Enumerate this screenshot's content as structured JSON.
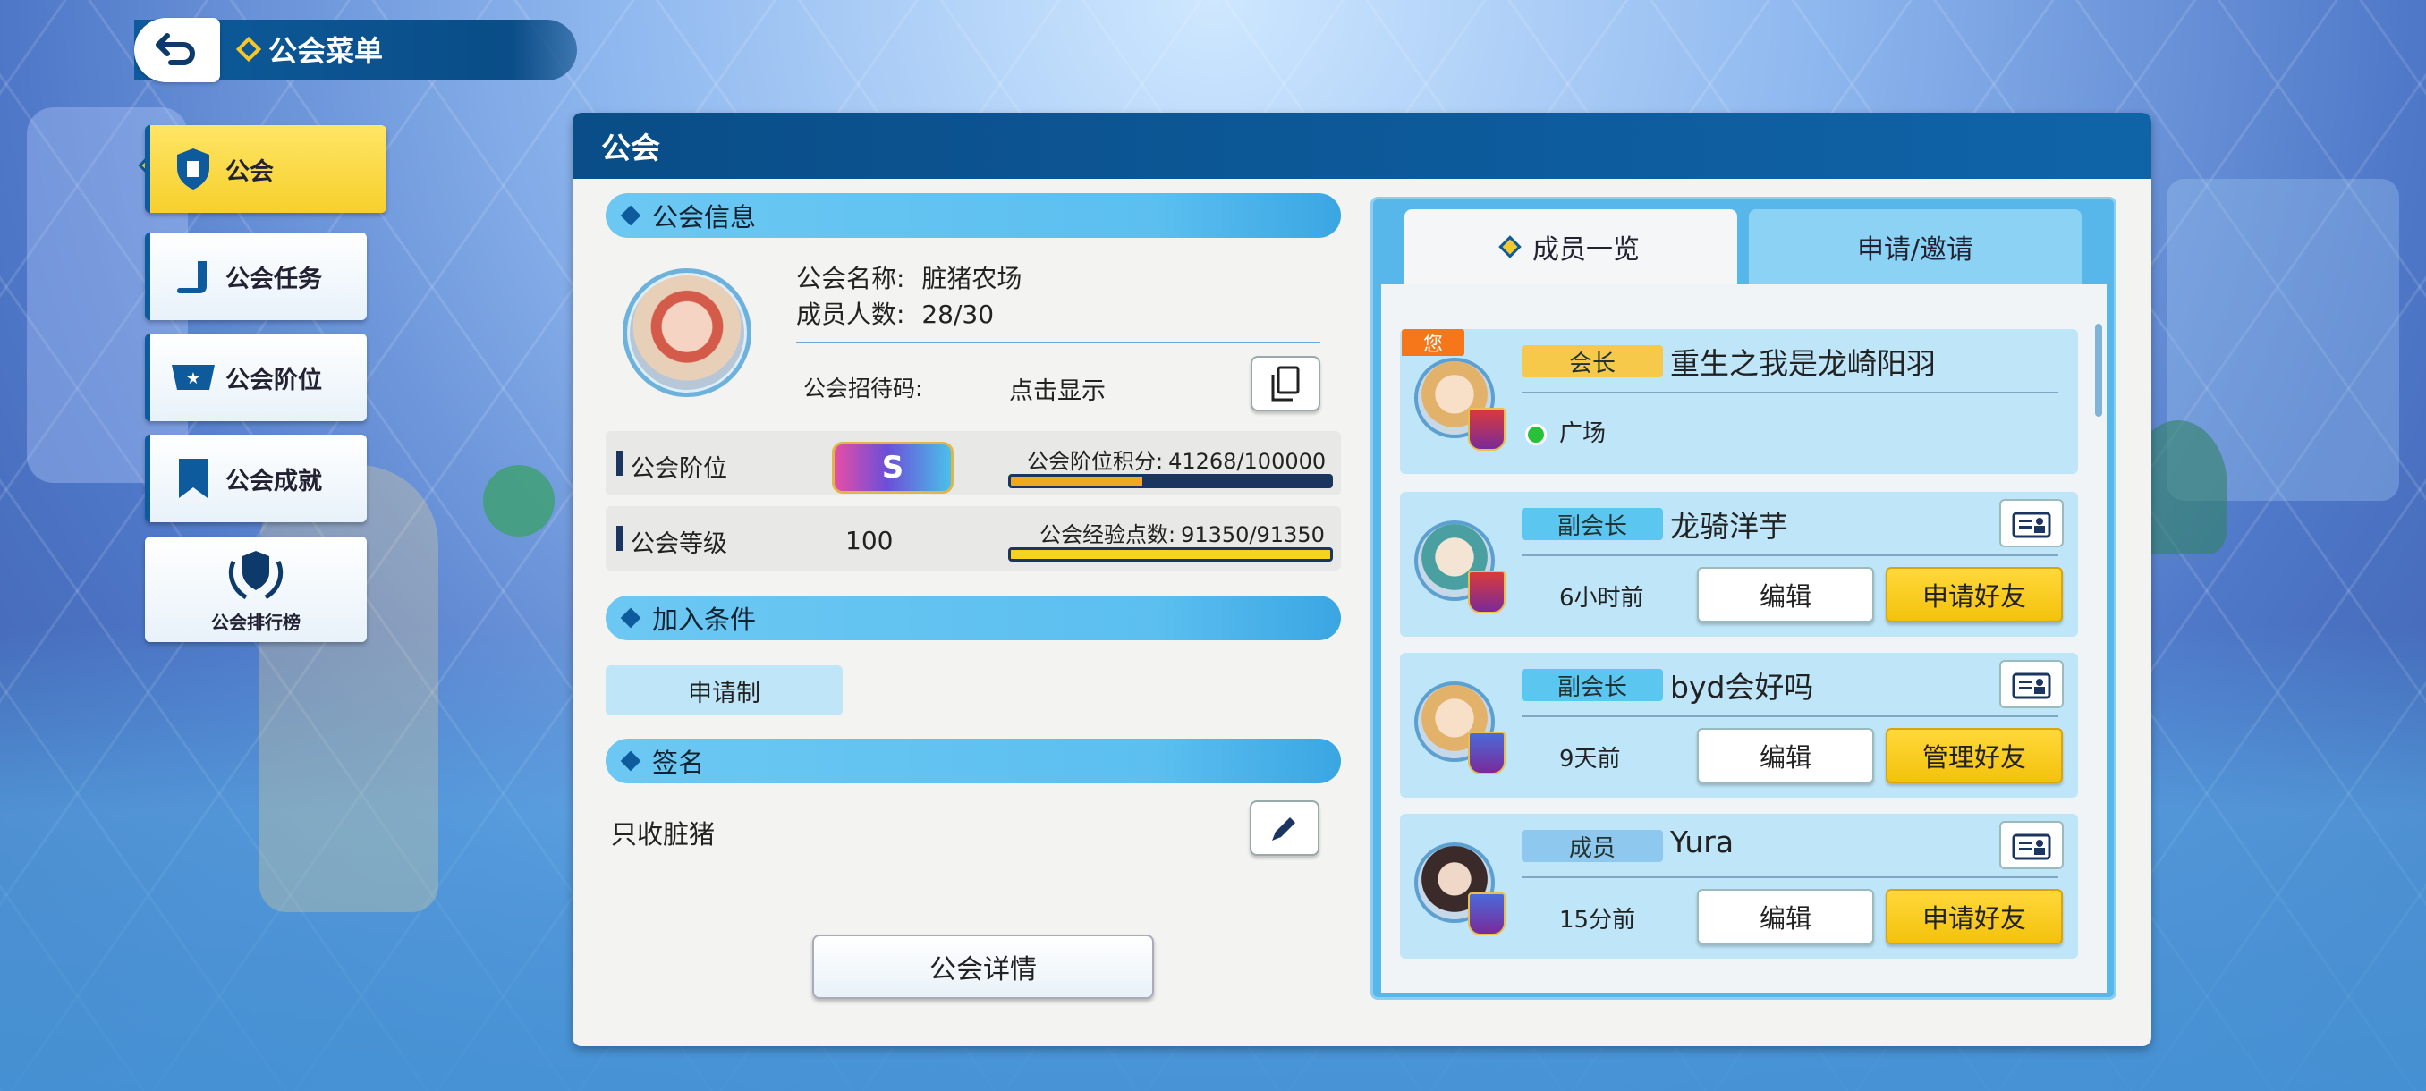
{
  "header": {
    "title": "公会菜单"
  },
  "sidebar": {
    "items": [
      {
        "label": "公会",
        "active": true
      },
      {
        "label": "公会任务"
      },
      {
        "label": "公会阶位"
      },
      {
        "label": "公会成就"
      },
      {
        "label": "公会排行榜"
      }
    ]
  },
  "panel": {
    "title": "公会"
  },
  "guild_info": {
    "section_title": "公会信息",
    "name_label": "公会名称:",
    "name_value": "脏猪农场",
    "members_label": "成员人数:",
    "members_value": "28/30",
    "invite_code_label": "公会招待码:",
    "invite_code_value": "点击显示",
    "rank_label": "公会阶位",
    "rank_grade": "S",
    "rank_points_label": "公会阶位积分:",
    "rank_points_value": "41268/100000",
    "rank_points_progress": 0.4127,
    "level_label": "公会等级",
    "level_value": "100",
    "exp_label": "公会经验点数:",
    "exp_value": "91350/91350",
    "exp_progress": 1.0
  },
  "join_conditions": {
    "section_title": "加入条件",
    "value": "申请制"
  },
  "signature": {
    "section_title": "签名",
    "value": "只收脏猪"
  },
  "detail_button": "公会详情",
  "members_panel": {
    "tabs": [
      {
        "label": "成员一览",
        "active": true
      },
      {
        "label": "申请/邀请"
      }
    ],
    "you_tag": "您",
    "members": [
      {
        "role": "会长",
        "name": "重生之我是龙崎阳羽",
        "status": "广场",
        "is_self": true
      },
      {
        "role": "副会长",
        "name": "龙骑洋芋",
        "time": "6小时前",
        "edit": "编辑",
        "action": "申请好友"
      },
      {
        "role": "副会长",
        "name": "byd会好吗",
        "time": "9天前",
        "edit": "编辑",
        "action": "管理好友"
      },
      {
        "role": "成员",
        "name": "Yura",
        "time": "15分前",
        "edit": "编辑",
        "action": "申请好友"
      }
    ]
  },
  "colors": {
    "header_blue": "#0d5b9c",
    "section_blue": "#5bbff0",
    "accent_yellow": "#f7c72a",
    "leader_role": "#f7c94a",
    "vice_role": "#5bc6f0",
    "member_role": "#8fc8ee",
    "rank_bar_fill": "#f0a81e",
    "exp_bar_fill": "#f7d21e"
  }
}
